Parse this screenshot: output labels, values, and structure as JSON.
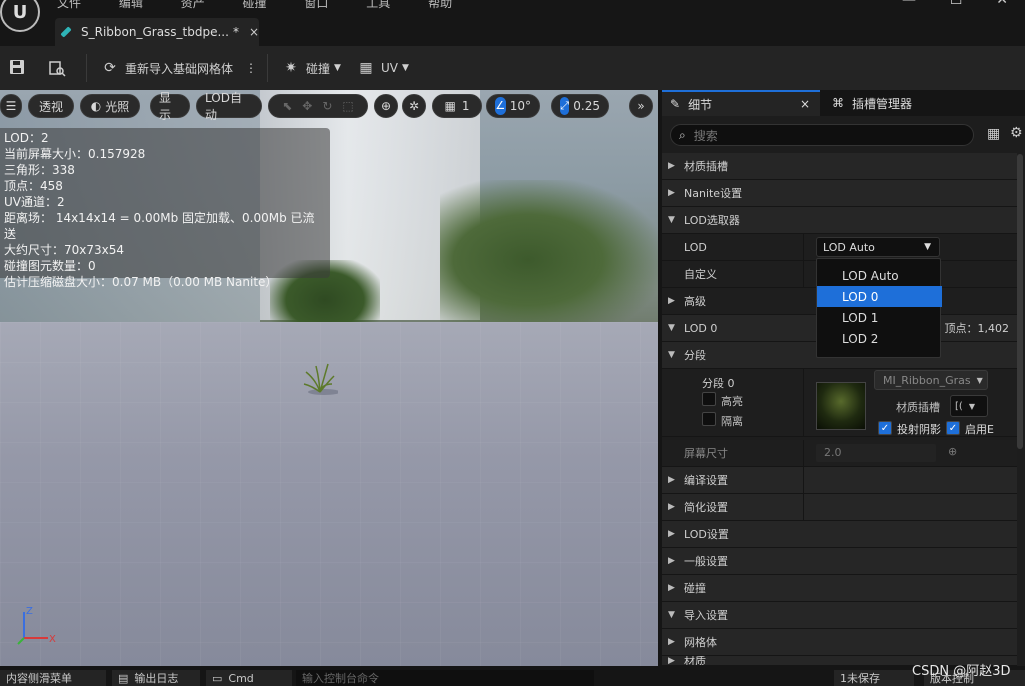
{
  "menu": [
    "文件",
    "编辑",
    "资产",
    "碰撞",
    "窗口",
    "工具",
    "帮助"
  ],
  "tab": {
    "title": "S_Ribbon_Grass_tbdpe...",
    "modified": "*",
    "close": "×"
  },
  "window": {
    "minimize": "—",
    "maximize": "☐",
    "close": "✕"
  },
  "toolbar": {
    "reimport": "重新导入基础网格体",
    "collision": "碰撞",
    "uv": "UV"
  },
  "viewport_buttons": {
    "perspective": "透视",
    "lit": "光照",
    "show": "显示",
    "lod": "LOD自动",
    "grid_value": "1",
    "angle_value": "10°",
    "scale_value": "0.25"
  },
  "stats": [
    "LOD：2",
    "当前屏幕大小：0.157928",
    "三角形：338",
    "顶点：458",
    "UV通道：2",
    "距离场： 14x14x14 = 0.00Mb 固定加载、0.00Mb 已流送",
    "大约尺寸：70x73x54",
    "碰撞图元数量：0",
    "估计压缩磁盘大小：0.07 MB（0.00 MB Nanite）"
  ],
  "gizmo": {
    "z": "Z",
    "x": "X"
  },
  "details": {
    "tab_details": "细节",
    "tab_close": "×",
    "tab_slots": "插槽管理器",
    "search_placeholder": "搜索",
    "rows": {
      "material_slots": "材质插槽",
      "nanite": "Nanite设置",
      "lod_picker": "LOD选取器",
      "lod": "LOD",
      "custom": "自定义",
      "advanced": "高级",
      "lod0": "LOD 0",
      "lod0_vertices": "顶点：1,402",
      "sections": "分段",
      "section0": "分段 0",
      "highlight": "高亮",
      "isolate": "隔离",
      "screen_size": "屏幕尺寸",
      "screen_size_value": "2.0",
      "build": "编译设置",
      "reduction": "简化设置",
      "lod_settings": "LOD设置",
      "general": "一般设置",
      "collision": "碰撞",
      "import": "导入设置",
      "mesh": "网格体",
      "material": "材质"
    },
    "lod_select_value": "LOD Auto",
    "dropdown": [
      "LOD Auto",
      "LOD 0",
      "LOD 1",
      "LOD 2"
    ],
    "dropdown_selected": "LOD 0",
    "material_name": "MI_Ribbon_Gras",
    "material_slot_label": "材质插槽",
    "material_slot_value": "[(",
    "cast_shadow": "投射阴影",
    "enable": "启用E"
  },
  "bottom": {
    "content_drawer": "内容侧滑菜单",
    "output_log": "输出日志",
    "cmd": "Cmd",
    "console_placeholder": "输入控制台命令",
    "unsaved": "1未保存",
    "source_control": "版本控制"
  },
  "watermark": "CSDN @阿赵3D",
  "colors": {
    "accent": "#1e6fd9",
    "tab_teal": "#2fb4b7"
  }
}
